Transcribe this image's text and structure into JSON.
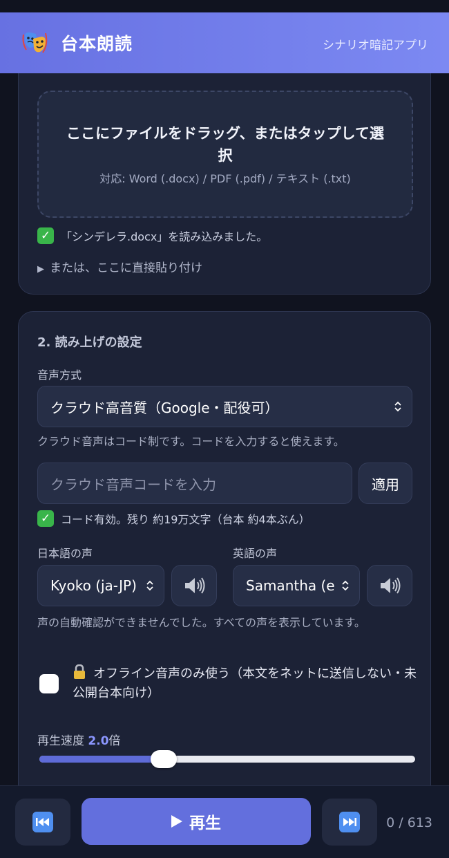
{
  "header": {
    "title": "台本朗読",
    "subtitle": "シナリオ暗記アプリ",
    "logo_icon": "theater-masks-icon"
  },
  "upload_section": {
    "dropzone_title": "ここにファイルをドラッグ、またはタップして選択",
    "dropzone_subtitle": "対応: Word (.docx) / PDF (.pdf) / テキスト (.txt)",
    "loaded_message": "「シンデレラ.docx」を読み込みました。",
    "paste_toggle": "または、ここに直接貼り付け"
  },
  "settings": {
    "section_title": "2. 読み上げの設定",
    "voice_mode_label": "音声方式",
    "voice_mode_value": "クラウド高音質（Google・配役可）",
    "cloud_hint": "クラウド音声はコード制です。コードを入力すると使えます。",
    "code_placeholder": "クラウド音声コードを入力",
    "apply_label": "適用",
    "code_status": "コード有効。残り 約19万文字（台本 約4本ぶん）",
    "japanese_voice_label": "日本語の声",
    "japanese_voice_value": "Kyoko (ja-JP)",
    "english_voice_label": "英語の声",
    "english_voice_value": "Samantha (en-US)",
    "voice_notice": "声の自動確認ができませんでした。すべての声を表示しています。",
    "offline_label": "オフライン音声のみ使う（本文をネットに送信しない・未公開台本向け）",
    "offline_checked": false,
    "speed_label": "再生速度",
    "speed_value": "2.0",
    "speed_unit": "倍",
    "speed_fraction": 0.33
  },
  "player": {
    "prev_icon": "skip-back-icon",
    "play_label": "再生",
    "next_icon": "skip-forward-icon",
    "counter": "0 / 613"
  },
  "colors": {
    "accent": "#636fdd",
    "header_gradient_start": "#6771e2",
    "success": "#39b54a"
  }
}
